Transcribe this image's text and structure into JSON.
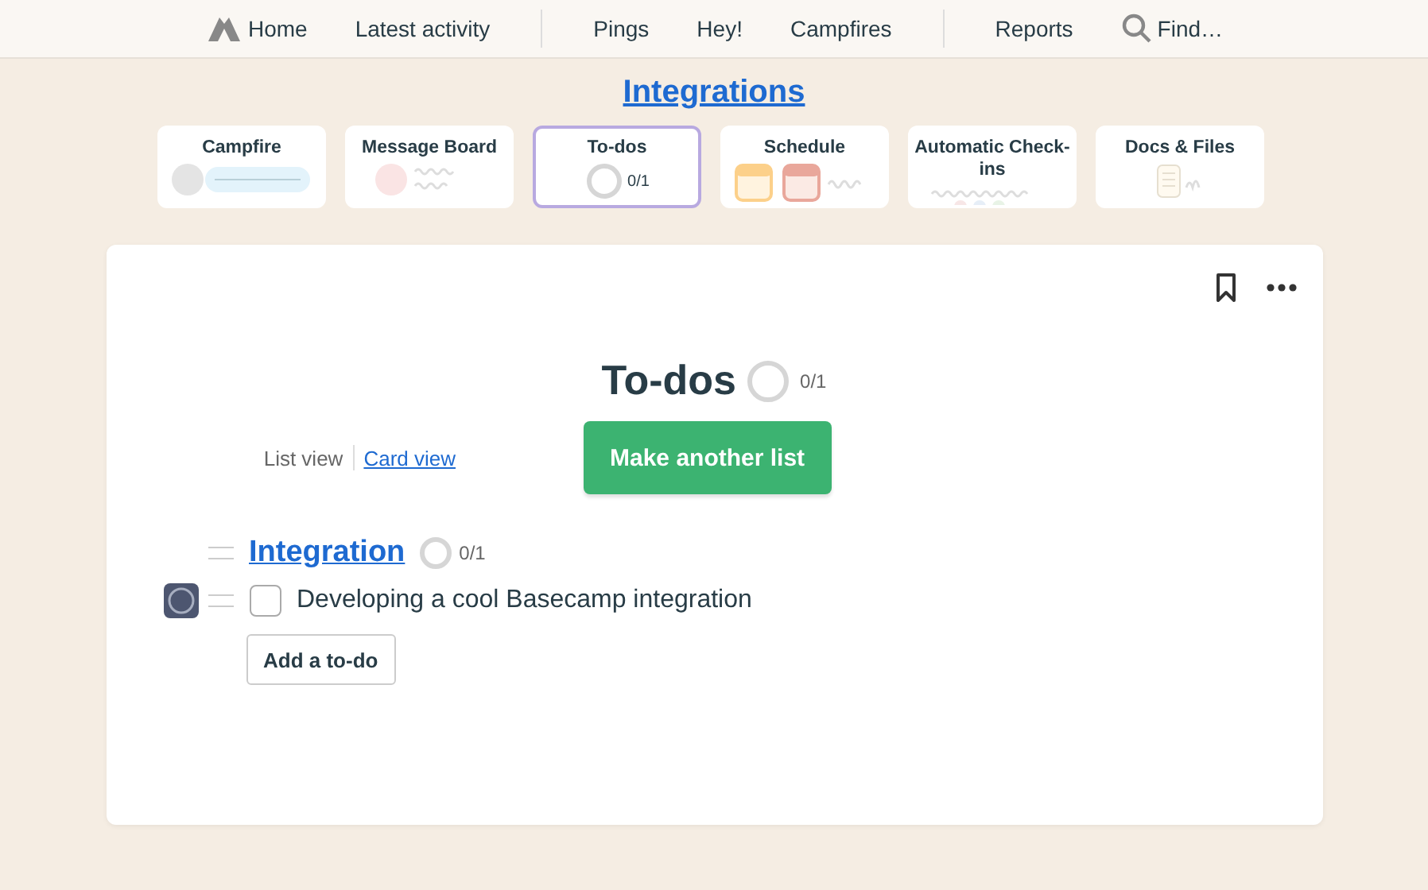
{
  "nav": [
    [
      {
        "label": "Home",
        "kind": "home"
      },
      {
        "label": "Latest activity"
      }
    ],
    [
      {
        "label": "Pings"
      },
      {
        "label": "Hey!"
      },
      {
        "label": "Campfires"
      }
    ],
    [
      {
        "label": "Reports"
      },
      {
        "label": "Find…",
        "kind": "search"
      }
    ]
  ],
  "project": {
    "title": "Integrations"
  },
  "tools": [
    {
      "title": "Campfire",
      "kind": "campfire",
      "selected": false
    },
    {
      "title": "Message Board",
      "kind": "board",
      "selected": false
    },
    {
      "title": "To-dos",
      "kind": "todos",
      "count": "0/1",
      "selected": true
    },
    {
      "title": "Schedule",
      "kind": "schedule",
      "selected": false
    },
    {
      "title": "Automatic Check-ins",
      "kind": "checkins",
      "selected": false
    },
    {
      "title": "Docs & Files",
      "kind": "docs",
      "selected": false
    }
  ],
  "panel": {
    "title": "To-dos",
    "count": "0/1",
    "views": [
      {
        "label": "List view",
        "selected": true
      },
      {
        "label": "Card view",
        "selected": false
      }
    ],
    "primary_button": "Make another list",
    "lists": [
      {
        "title": "Integration",
        "count": "0/1",
        "items": [
          {
            "text": "Developing a cool Basecamp integration",
            "checked": false
          }
        ],
        "add_button": "Add a to-do"
      }
    ]
  }
}
